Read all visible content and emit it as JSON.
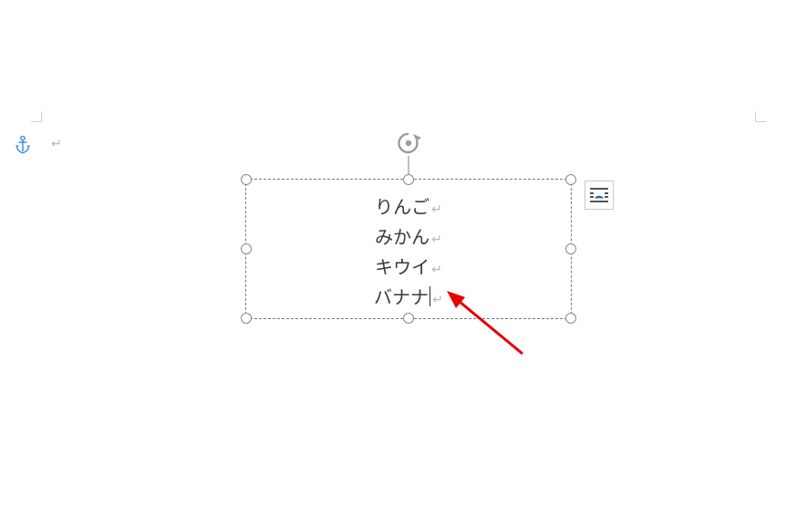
{
  "textbox": {
    "lines": [
      {
        "text": "りんご",
        "has_cursor": false
      },
      {
        "text": "みかん",
        "has_cursor": false
      },
      {
        "text": "キウイ",
        "has_cursor": false
      },
      {
        "text": "バナナ",
        "has_cursor": true
      }
    ]
  },
  "para_mark": "↵",
  "icons": {
    "anchor": "anchor-icon",
    "rotation": "rotation-handle-icon",
    "layout": "layout-options-icon"
  },
  "colors": {
    "anchor": "#3a8fd6",
    "handle_border": "#8a8a8a",
    "textbox_border": "#7a7a7a",
    "arrow": "#e60000",
    "layout_accent": "#2467a8"
  }
}
